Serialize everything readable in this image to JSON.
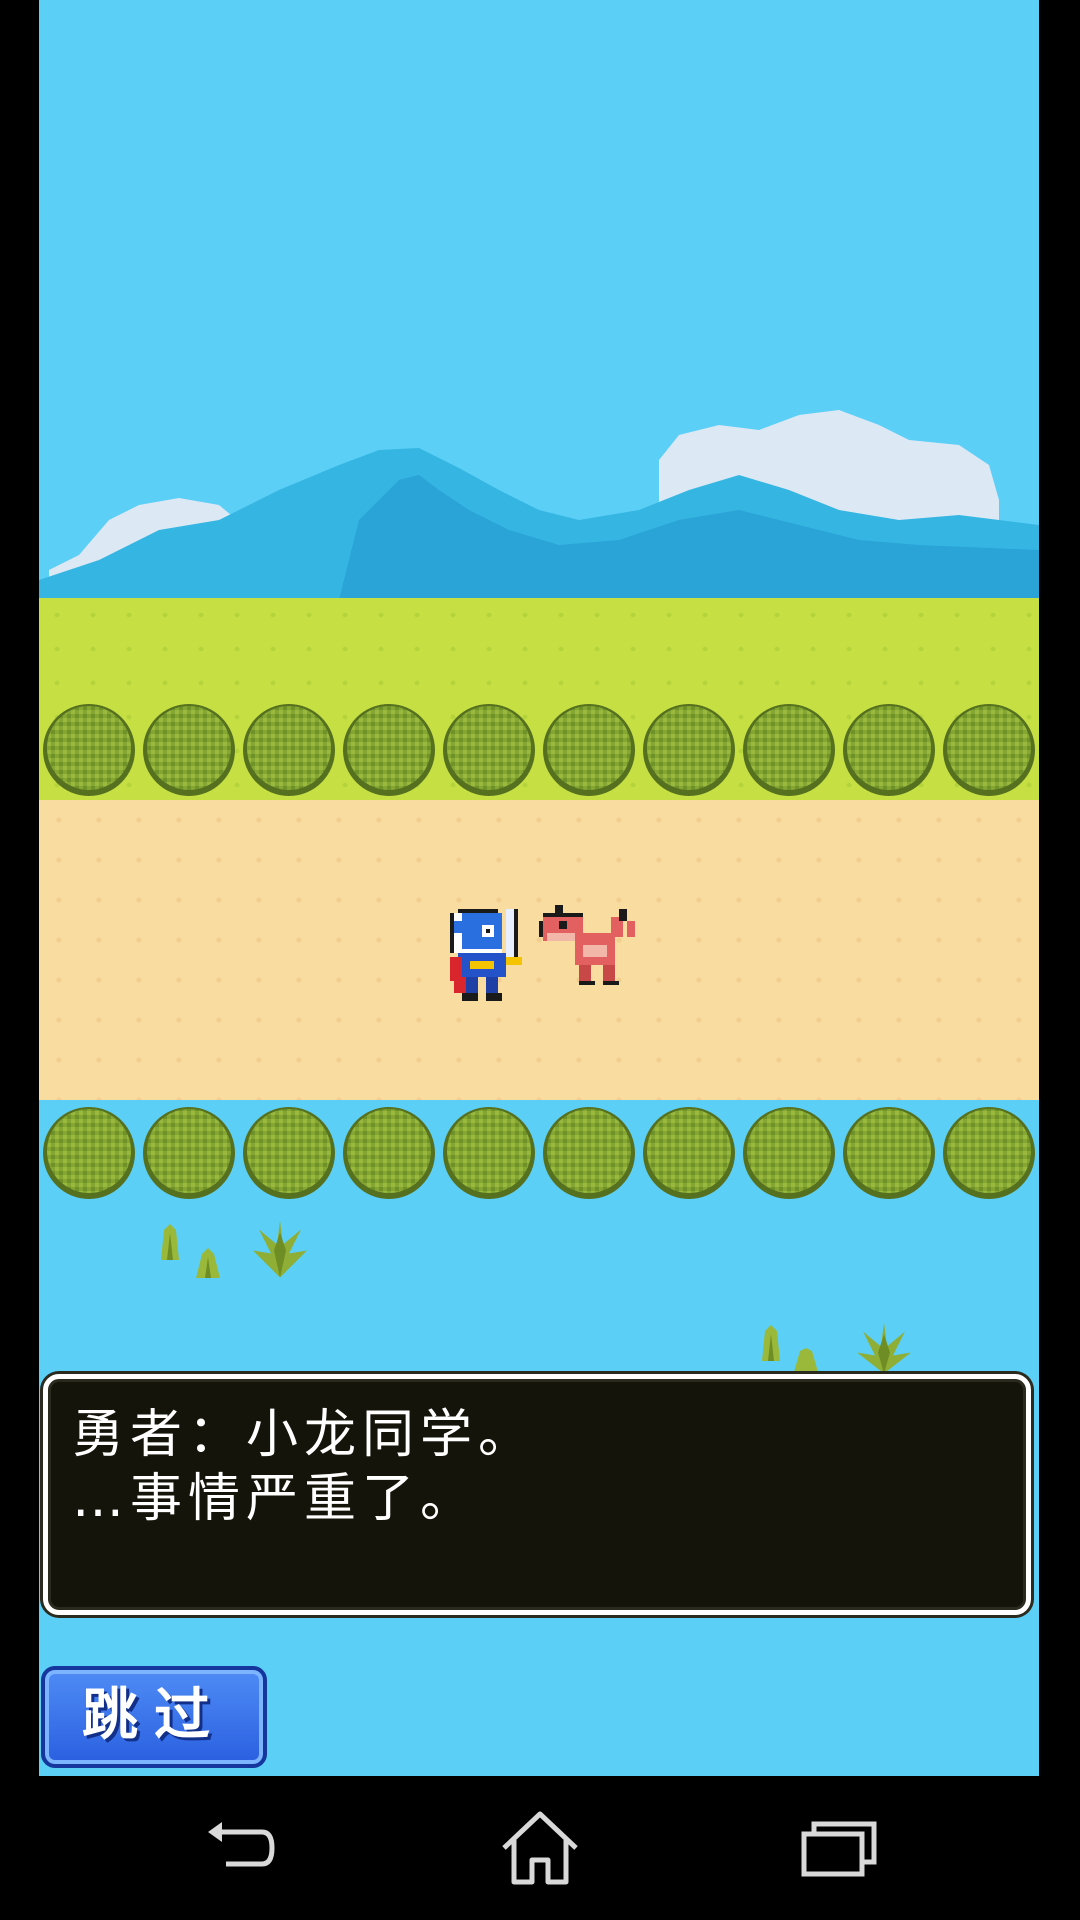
{
  "dialog": {
    "line1": "勇者：小龙同学。",
    "line2": "…事情严重了。"
  },
  "skip_button": {
    "label": "跳过"
  },
  "scene": {
    "sprites": [
      "hero-knight",
      "red-dragon"
    ],
    "colors": {
      "sky": "#5ccff7",
      "grass": "#c6e044",
      "road": "#f9dca0",
      "bush": "#7fa22c",
      "dialog_bg": "#15140a",
      "skip_button": "#2f6ae8"
    }
  },
  "navbar": {
    "icons": [
      "back-icon",
      "home-icon",
      "recents-icon"
    ]
  }
}
